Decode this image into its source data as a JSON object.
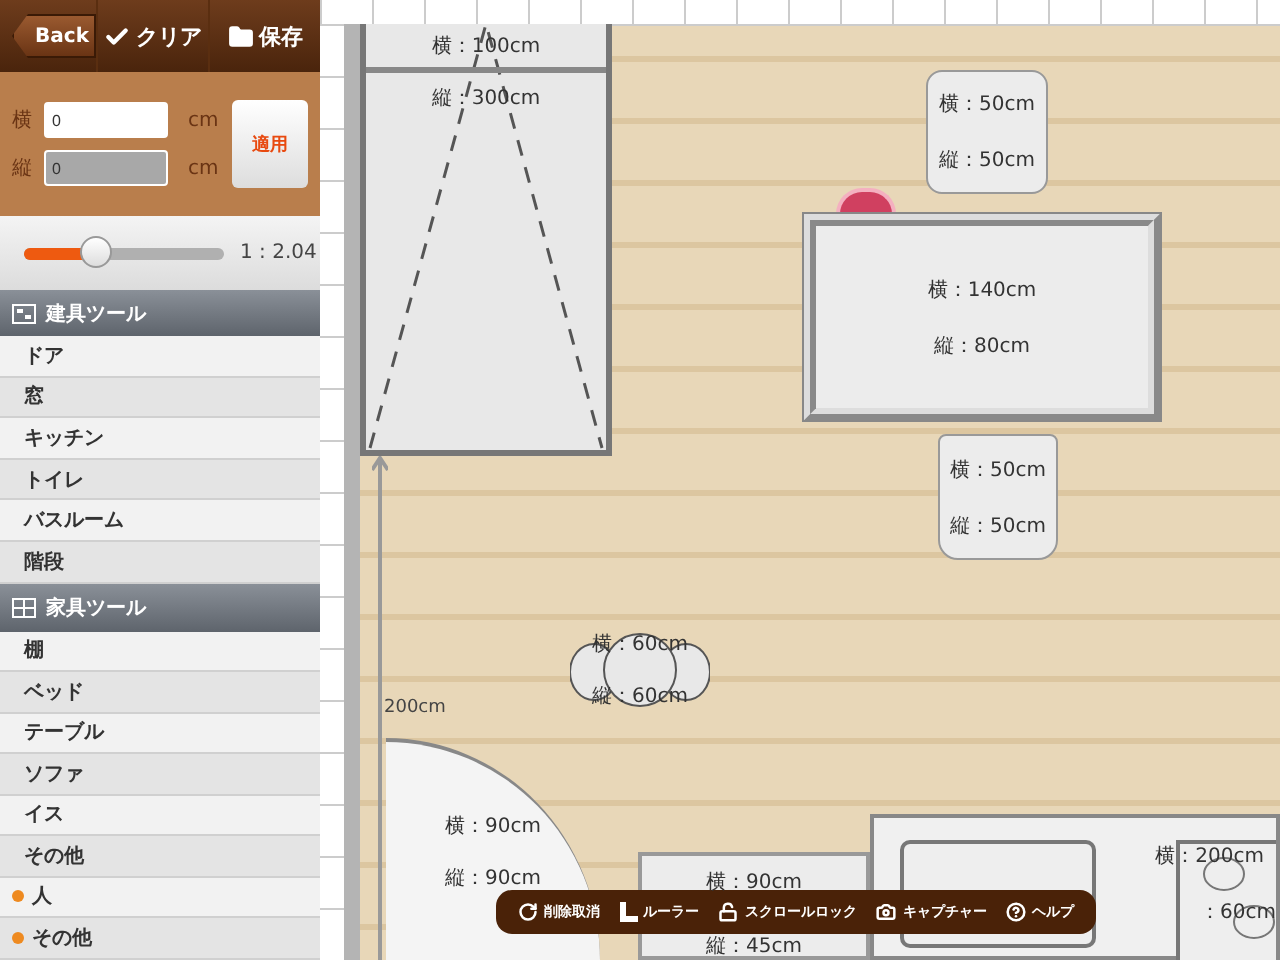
{
  "toolbar": {
    "back": "Back",
    "clear": "クリア",
    "save": "保存"
  },
  "size_form": {
    "fields": [
      {
        "label": "横",
        "value": "0",
        "unit": "cm",
        "disabled": false
      },
      {
        "label": "縦",
        "value": "0",
        "unit": "cm",
        "disabled": true
      }
    ],
    "apply": "適用"
  },
  "scale": {
    "level": 0.36,
    "reading": "1 : 2.04"
  },
  "sections": [
    {
      "title": "建具ツール",
      "items": [
        {
          "label": "ドア",
          "kind": "plain"
        },
        {
          "label": "窓",
          "kind": "plain"
        },
        {
          "label": "キッチン",
          "kind": "plain"
        },
        {
          "label": "トイレ",
          "kind": "plain"
        },
        {
          "label": "バスルーム",
          "kind": "plain"
        },
        {
          "label": "階段",
          "kind": "plain"
        }
      ]
    },
    {
      "title": "家具ツール",
      "items": [
        {
          "label": "棚",
          "kind": "plain"
        },
        {
          "label": "ベッド",
          "kind": "plain"
        },
        {
          "label": "テーブル",
          "kind": "plain"
        },
        {
          "label": "ソファ",
          "kind": "plain"
        },
        {
          "label": "イス",
          "kind": "plain"
        },
        {
          "label": "その他",
          "kind": "plain"
        },
        {
          "label": "人",
          "kind": "dotted"
        },
        {
          "label": "その他",
          "kind": "dotted"
        }
      ]
    }
  ],
  "canvas": {
    "objects": [
      {
        "kind": "bed",
        "lines": [
          "横：100cm",
          "縦：300cm"
        ]
      },
      {
        "kind": "chair",
        "lines": [
          "横：50cm",
          "縦：50cm"
        ]
      },
      {
        "kind": "table",
        "lines": [
          "横：140cm",
          "縦：80cm"
        ]
      },
      {
        "kind": "chair",
        "lines": [
          "横：50cm",
          "縦：50cm"
        ]
      },
      {
        "kind": "round_table",
        "lines": [
          "横：60cm",
          "縦：60cm"
        ]
      },
      {
        "kind": "door",
        "lines": [
          "横：90cm",
          "縦：90cm"
        ]
      },
      {
        "kind": "box",
        "lines": [
          "横：90cm",
          "縦：45cm"
        ]
      },
      {
        "kind": "counter",
        "lines": [
          "横：200cm",
          "：60cm"
        ]
      }
    ],
    "dimension": "200cm"
  },
  "bottom_toolbar": [
    {
      "label": "削除取消"
    },
    {
      "label": "ルーラー"
    },
    {
      "label": "スクロールロック"
    },
    {
      "label": "キャプチャー"
    },
    {
      "label": "ヘルプ"
    }
  ]
}
